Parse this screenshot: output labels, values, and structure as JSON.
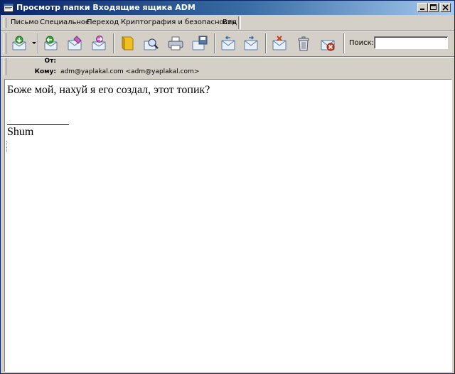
{
  "window": {
    "title": "Просмотр папки Входящие ящика ADM",
    "controls": [
      "minimize",
      "maximize",
      "close"
    ]
  },
  "menu": {
    "items": [
      {
        "label": "Письмо"
      },
      {
        "label": "Специальное"
      },
      {
        "label": "Переход"
      },
      {
        "label": "Криптография и безопасность"
      },
      {
        "label": "Вид"
      }
    ]
  },
  "toolbar": {
    "buttons": [
      {
        "icon": "get-mail-icon"
      },
      {
        "icon": "reply-icon"
      },
      {
        "icon": "compose-icon"
      },
      {
        "icon": "forward-icon"
      },
      {
        "icon": "address-book-icon"
      },
      {
        "icon": "find-icon"
      },
      {
        "icon": "print-icon"
      },
      {
        "icon": "save-icon"
      },
      {
        "icon": "previous-icon"
      },
      {
        "icon": "next-icon"
      },
      {
        "icon": "mark-icon"
      },
      {
        "icon": "delete-icon"
      },
      {
        "icon": "junk-icon"
      }
    ],
    "search_label": "Поиск:",
    "search_value": ""
  },
  "headers": {
    "from_label": "От:",
    "from_value": "",
    "to_label": "Кому:",
    "to_value": "adm@yaplakal.com <adm@yaplakal.com>"
  },
  "message": {
    "line1": "Боже мой, нахуй я его создал, этот топик?",
    "signature": "Shum"
  },
  "colors": {
    "titlebar_start": "#0a246a",
    "titlebar_end": "#a6caf0",
    "chrome": "#d4d0c8"
  }
}
